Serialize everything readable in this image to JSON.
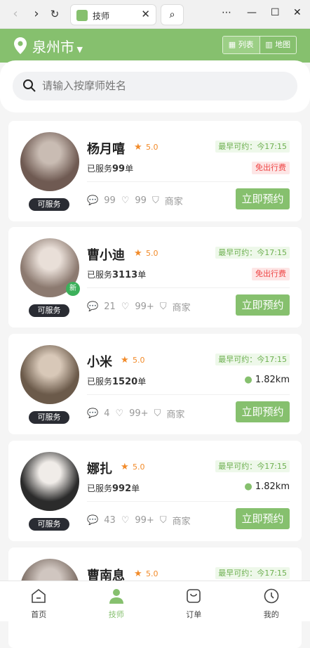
{
  "browser": {
    "tab_title": "技师"
  },
  "header": {
    "city": "泉州市",
    "view_list": "列表",
    "view_map": "地图"
  },
  "search": {
    "placeholder": "请输入按摩师姓名"
  },
  "therapists": [
    {
      "name": "杨月嘻",
      "rating": "5.0",
      "avail": "最早可约：今17:15",
      "served_prefix": "已服务",
      "served_count": "99",
      "served_suffix": "单",
      "badge": "免出行费",
      "distance": "",
      "comments": "99",
      "likes": "99",
      "shop": "商家",
      "status": "可服务",
      "book": "立即预约"
    },
    {
      "name": "曹小迪",
      "rating": "5.0",
      "avail": "最早可约：今17:15",
      "served_prefix": "已服务",
      "served_count": "3113",
      "served_suffix": "单",
      "badge": "免出行费",
      "distance": "",
      "comments": "21",
      "likes": "99+",
      "shop": "商家",
      "status": "可服务",
      "book": "立即预约",
      "new": "新"
    },
    {
      "name": "小米",
      "rating": "5.0",
      "avail": "最早可约：今17:15",
      "served_prefix": "已服务",
      "served_count": "1520",
      "served_suffix": "单",
      "badge": "",
      "distance": "1.82km",
      "comments": "4",
      "likes": "99+",
      "shop": "商家",
      "status": "可服务",
      "book": "立即预约"
    },
    {
      "name": "娜扎",
      "rating": "5.0",
      "avail": "最早可约：今17:15",
      "served_prefix": "已服务",
      "served_count": "992",
      "served_suffix": "单",
      "badge": "",
      "distance": "1.82km",
      "comments": "43",
      "likes": "99+",
      "shop": "商家",
      "status": "可服务",
      "book": "立即预约"
    },
    {
      "name": "曹南息",
      "rating": "5.0",
      "avail": "最早可约：今17:15"
    }
  ],
  "tabbar": {
    "home": "首页",
    "tech": "技师",
    "orders": "订单",
    "mine": "我的"
  }
}
